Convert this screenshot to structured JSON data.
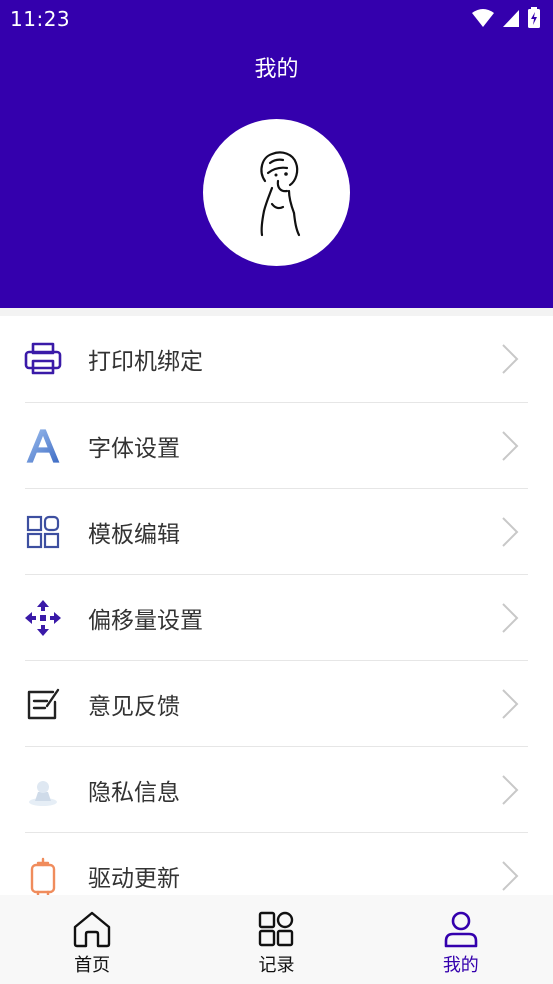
{
  "status_bar": {
    "time": "11:23",
    "icons": [
      "wifi-icon",
      "signal-icon",
      "battery-icon"
    ]
  },
  "header": {
    "title": "我的",
    "background_color": "#3400ad",
    "avatar_icon": "avatar-sketch-icon"
  },
  "menu": {
    "items": [
      {
        "label": "打印机绑定",
        "icon": "printer-icon"
      },
      {
        "label": "字体设置",
        "icon": "font-icon"
      },
      {
        "label": "模板编辑",
        "icon": "grid-icon"
      },
      {
        "label": "偏移量设置",
        "icon": "offset-arrows-icon"
      },
      {
        "label": "意见反馈",
        "icon": "feedback-icon"
      },
      {
        "label": "隐私信息",
        "icon": "privacy-icon"
      },
      {
        "label": "驱动更新",
        "icon": "driver-update-icon"
      }
    ],
    "arrow_icon": "chevron-right-icon"
  },
  "bottom_nav": {
    "active_color": "#3400ad",
    "items": [
      {
        "label": "首页",
        "icon": "home-icon",
        "active": false
      },
      {
        "label": "记录",
        "icon": "records-icon",
        "active": false
      },
      {
        "label": "我的",
        "icon": "profile-icon",
        "active": true
      }
    ]
  }
}
